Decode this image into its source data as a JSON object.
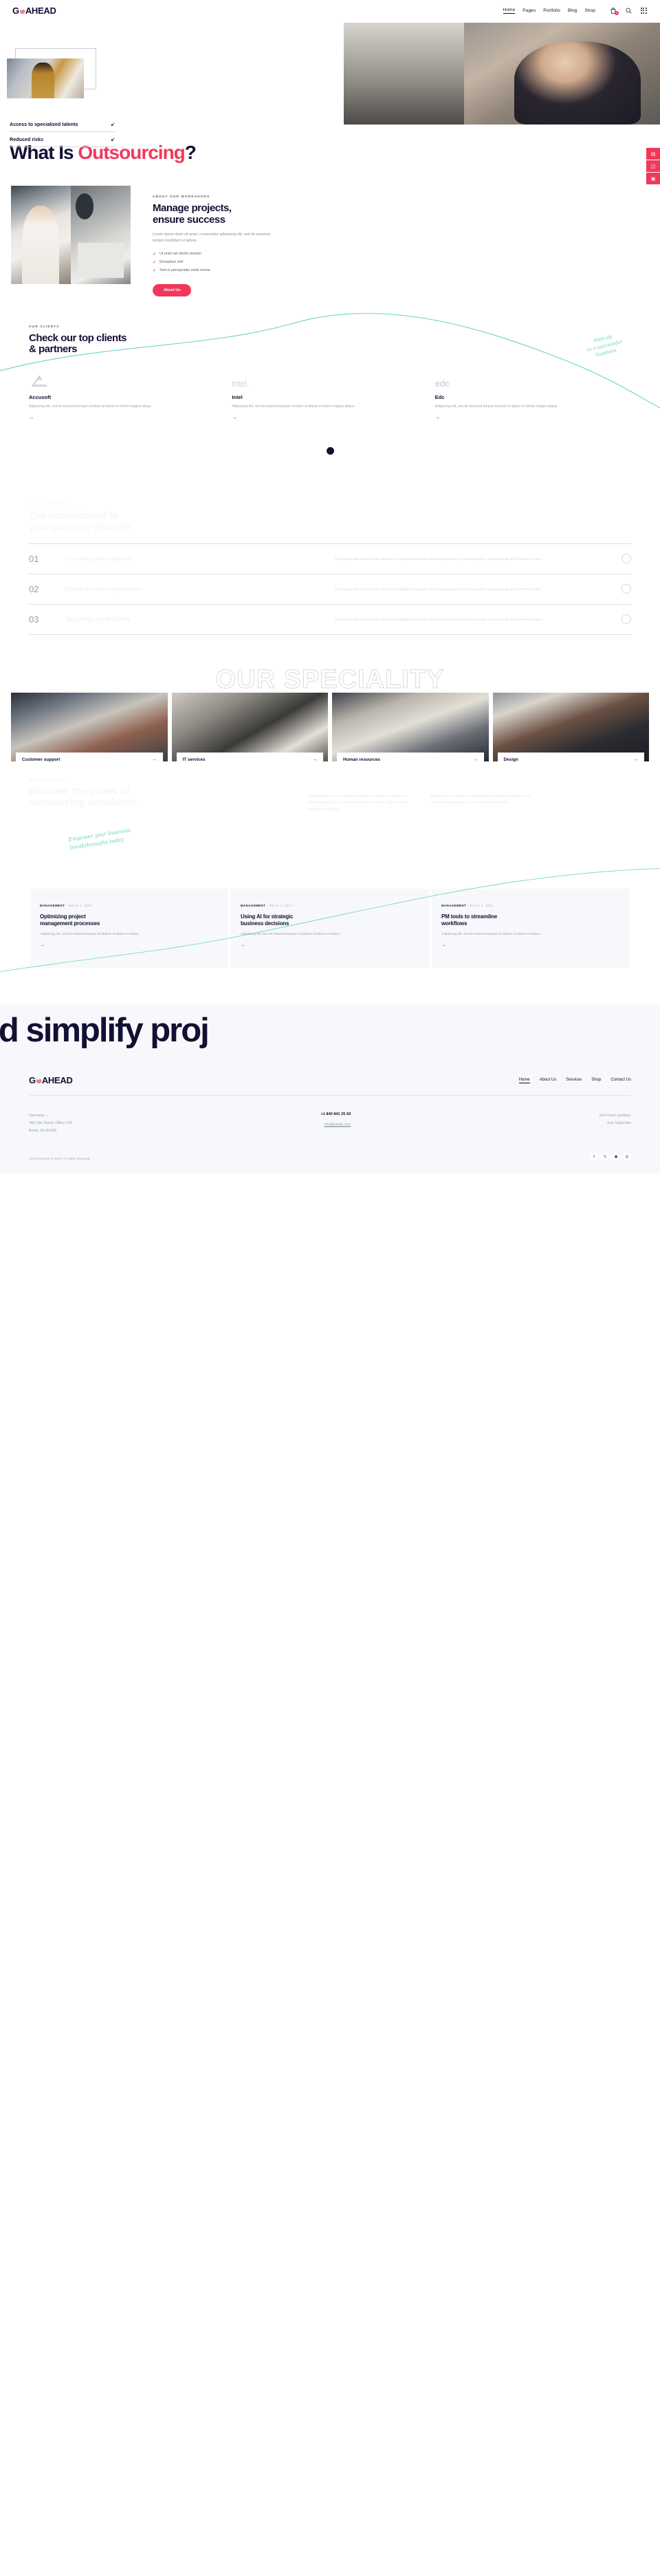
{
  "brand": {
    "name": "GOAHEAD",
    "accent": "#f2385a",
    "ink": "#131033",
    "mint": "#67d6bd"
  },
  "header": {
    "nav": [
      {
        "label": "Home",
        "active": true
      },
      {
        "label": "Pages",
        "active": false
      },
      {
        "label": "Portfolio",
        "active": false
      },
      {
        "label": "Blog",
        "active": false
      },
      {
        "label": "Shop",
        "active": false
      }
    ],
    "cart_icon": "cart-icon",
    "cart_count": "0",
    "search_icon": "search-icon",
    "grid_icon": "grid-menu-icon"
  },
  "hero": {
    "items": [
      {
        "label": "Access to specialized talents",
        "arrow": "↙"
      },
      {
        "label": "Reduced risks",
        "arrow": "↙"
      }
    ],
    "side_tabs": [
      "▤",
      "◫",
      "▣"
    ]
  },
  "title": {
    "pre": "What Is ",
    "accent": "Outsourcing",
    "post": "?"
  },
  "about": {
    "eyebrow": "ABOUT OUR WORKSHOPS",
    "heading_line1": "Manage projects,",
    "heading_line2": "ensure success",
    "paragraph": "Lorem ipsum dolor sit amet, consectetur adipiscing elit, sed do eiusmod tempor incididunt ut labore.",
    "checks": [
      "Ut enim ad minim veniam",
      "Excepteur sint",
      "Sed ut perspiciatis unde omnis"
    ],
    "button": "About Us"
  },
  "clients": {
    "eyebrow": "OUR CLIENTS",
    "heading_line1": "Check our top clients",
    "heading_line2": "& partners",
    "script_note_line1": "Step up",
    "script_note_line2": "to a successful",
    "script_note_line3": "business",
    "items": [
      {
        "logo": "accusoft-logo",
        "name": "Accusoft",
        "desc": "Adipiscing elit, sed do eiusmod tempor incidunt ut labore et dolore magna aliqua.",
        "arrow": "→"
      },
      {
        "logo": "intel-logo",
        "name": "Intel",
        "desc": "Adipiscing elit, sed do eiusmod tempor incidunt ut labore et dolore magna aliqua.",
        "arrow": "→"
      },
      {
        "logo": "edc-logo",
        "name": "Edc",
        "desc": "Adipiscing elit, sed do eiusmod tempor incidunt ut labore et dolore magna aliqua.",
        "arrow": "→"
      }
    ]
  },
  "commitment": {
    "eyebrow": "OUR COMMITMENT",
    "heading_line1": "Our commitment to",
    "heading_line2": "your projects' triumph",
    "rows": [
      {
        "num": "01",
        "title": "Cost reduction measures",
        "desc": "Sed ut perspiciatis unde omnis iste natus error sit voluptatem accusantium doloremque laudantium, totam rem aperiam, eaque ipsa quae ab illo inventore veritatis."
      },
      {
        "num": "02",
        "title": "Focus on core competencies",
        "desc": "Sed ut perspiciatis unde omnis iste natus error sit voluptatem accusantium doloremque laudantium, totam rem aperiam, eaque ipsa quae ab illo inventore veritatis."
      },
      {
        "num": "03",
        "title": "Scalability and flexibility",
        "desc": "Sed ut perspiciatis unde omnis iste natus error sit voluptatem accusantium doloremque laudantium, totam rem aperiam, eaque ipsa quae ab illo inventore veritatis."
      }
    ]
  },
  "speciality": {
    "outline_text": "OUR SPECIALITY",
    "cards": [
      {
        "label": "Customer support",
        "arrow": "→",
        "image": "customer-support-photo"
      },
      {
        "label": "IT services",
        "arrow": "→",
        "image": "it-services-photo"
      },
      {
        "label": "Human resources",
        "arrow": "→",
        "image": "human-resources-photo"
      },
      {
        "label": "Design",
        "arrow": "→",
        "image": "design-photo"
      }
    ]
  },
  "expertise": {
    "eyebrow": "WHY CHOOSE US",
    "heading_line1": "Discover the power of",
    "heading_line2": "outsourcing excellence",
    "para1": "Adipiscing elit, sed do eiusmod tempor incididunt ut labore et dolore magna aliqua. Ut enim ad minim veniam, quis nostrud exercitation ullamco.",
    "para2": "Adipiscing elit, sed do eiusmod tempor incididunt ut labore et dolore magna aliqua. Ut enim ad minim veniam.",
    "script_note_line1": "Empower your business",
    "script_note_line2": "breakthroughs today"
  },
  "blog": {
    "posts": [
      {
        "category": "MANAGEMENT",
        "sep": "•",
        "date": "March 1, 2024",
        "title_line1": "Optimizing project",
        "title_line2": "management processes",
        "desc": "Adipiscing elit, sed do eiusmod tempor incididunt ut labore et dolore.",
        "arrow": "→"
      },
      {
        "category": "MANAGEMENT",
        "sep": "•",
        "date": "March 1, 2024",
        "title_line1": "Using AI for strategic",
        "title_line2": "business decisions",
        "desc": "Adipiscing elit, sed do eiusmod tempor incididunt ut labore et dolore.",
        "arrow": "→"
      },
      {
        "category": "MANAGEMENT",
        "sep": "•",
        "date": "March 1, 2024",
        "title_line1": "PM tools to streamline",
        "title_line2": "workflows",
        "desc": "Adipiscing elit, sed do eiusmod tempor incididunt ut labore et dolore.",
        "arrow": "→"
      }
    ]
  },
  "marquee": {
    "text": "nd simplify proj"
  },
  "footer": {
    "logo": "GOAHEAD",
    "nav": [
      {
        "label": "Home",
        "active": true
      },
      {
        "label": "About Us",
        "active": false
      },
      {
        "label": "Services",
        "active": false
      },
      {
        "label": "Shop",
        "active": false
      },
      {
        "label": "Contact Us",
        "active": false
      }
    ],
    "address_line1": "Germany —",
    "address_line2": "785 15h Street, Office 478",
    "address_line3": "Berlin, De 81566",
    "phone": "+1 840 841 25 69",
    "email": "info@email.com",
    "subscribe_line1": "Get Fresh updates.",
    "subscribe_line2": "Just Subscribe",
    "copyright": "AxiomThemes © 2024. All rights reserved.",
    "socials": [
      {
        "icon": "facebook-icon",
        "glyph": "f"
      },
      {
        "icon": "x-twitter-icon",
        "glyph": "𝕏"
      },
      {
        "icon": "dribbble-icon",
        "glyph": "◉"
      },
      {
        "icon": "instagram-icon",
        "glyph": "◎"
      }
    ]
  }
}
